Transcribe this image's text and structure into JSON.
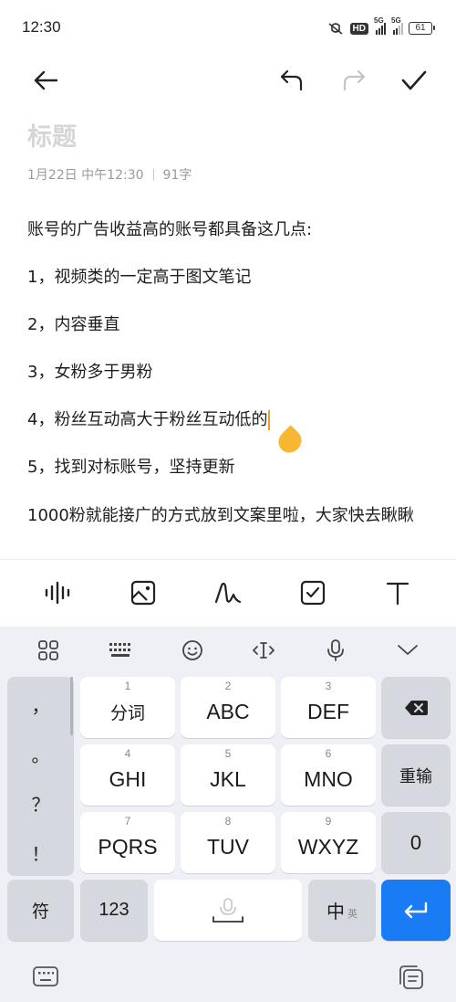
{
  "status_bar": {
    "time": "12:30",
    "hd_label": "HD",
    "network1": "5G",
    "network2": "5G",
    "battery": "61"
  },
  "toolbar": {
    "back_icon": "arrow-left-icon",
    "undo_icon": "undo-icon",
    "redo_icon": "redo-icon",
    "done_icon": "check-icon"
  },
  "note": {
    "title_placeholder": "标题",
    "date": "1月22日 中午12:30",
    "word_count": "91字",
    "lines": [
      "账号的广告收益高的账号都具备这几点:",
      "1，视频类的一定高于图文笔记",
      "2，内容垂直",
      "3，女粉多于男粉",
      "4，粉丝互动高大于粉丝互动低的",
      "5，找到对标账号，坚持更新",
      "1000粉就能接广的方式放到文案里啦，大家快去瞅瞅"
    ]
  },
  "format_bar": {
    "items": [
      "voice-wave-icon",
      "image-icon",
      "handwriting-icon",
      "checkbox-icon",
      "text-format-icon"
    ]
  },
  "keyboard": {
    "toolbar": [
      "grid-menu-icon",
      "keyboard-icon",
      "emoji-icon",
      "cursor-move-icon",
      "microphone-icon",
      "chevron-down-icon"
    ],
    "punctuation": [
      "，",
      "。",
      "？",
      "！"
    ],
    "keys": [
      {
        "num": "1",
        "label": "分词"
      },
      {
        "num": "2",
        "label": "ABC"
      },
      {
        "num": "3",
        "label": "DEF"
      },
      {
        "num": "4",
        "label": "GHI"
      },
      {
        "num": "5",
        "label": "JKL"
      },
      {
        "num": "6",
        "label": "MNO"
      },
      {
        "num": "7",
        "label": "PQRS"
      },
      {
        "num": "8",
        "label": "TUV"
      },
      {
        "num": "9",
        "label": "WXYZ"
      }
    ],
    "backspace_icon": "backspace-icon",
    "reenter": "重输",
    "zero": "0",
    "symbol": "符",
    "num123": "123",
    "lang_cn": "中",
    "lang_en": "英",
    "enter_icon": "enter-icon",
    "colors": {
      "enter": "#1a7cf5",
      "accent_cursor": "#f0a020"
    }
  },
  "bottom_bar": {
    "left_icon": "keyboard-switch-icon",
    "right_icon": "clipboard-icon"
  }
}
